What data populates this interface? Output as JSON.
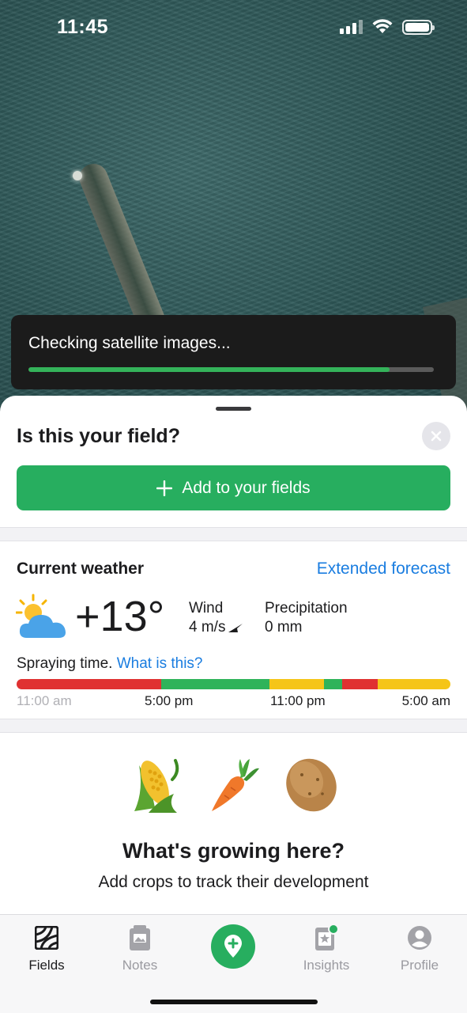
{
  "status_bar": {
    "time": "11:45"
  },
  "toast": {
    "text": "Checking satellite images...",
    "progress": 0.89
  },
  "sheet": {
    "title": "Is this your field?",
    "add_button_label": "Add to your fields"
  },
  "weather": {
    "title": "Current weather",
    "forecast_link": "Extended forecast",
    "temperature": "+13°",
    "wind_label": "Wind",
    "wind_value": "4 m/s",
    "precip_label": "Precipitation",
    "precip_value": "0 mm",
    "spraying_label": "Spraying time.",
    "spraying_link": "What is this?",
    "spray_segments": [
      {
        "fraction": 0.333,
        "status": "unfavorable",
        "color": "#e03131"
      },
      {
        "fraction": 0.25,
        "status": "favorable",
        "color": "#2fb35a"
      },
      {
        "fraction": 0.125,
        "status": "moderate",
        "color": "#f5c518"
      },
      {
        "fraction": 0.042,
        "status": "favorable",
        "color": "#2fb35a"
      },
      {
        "fraction": 0.083,
        "status": "unfavorable",
        "color": "#e03131"
      },
      {
        "fraction": 0.167,
        "status": "moderate",
        "color": "#f5c518"
      }
    ],
    "time_labels": [
      "11:00 am",
      "5:00 pm",
      "11:00 pm",
      "5:00 am"
    ]
  },
  "crops": {
    "icons": [
      "corn-icon",
      "carrot-icon",
      "potato-icon"
    ],
    "title": "What's growing here?",
    "subtitle": "Add crops to track their development"
  },
  "tabs": [
    {
      "label": "Fields",
      "icon": "fields-icon",
      "active": true
    },
    {
      "label": "Notes",
      "icon": "notes-icon",
      "active": false
    },
    {
      "label": "Insights",
      "icon": "insights-icon",
      "active": false,
      "badge": true
    },
    {
      "label": "Profile",
      "icon": "profile-icon",
      "active": false
    }
  ],
  "colors": {
    "accent": "#27ae5f",
    "link": "#1a7de0"
  }
}
